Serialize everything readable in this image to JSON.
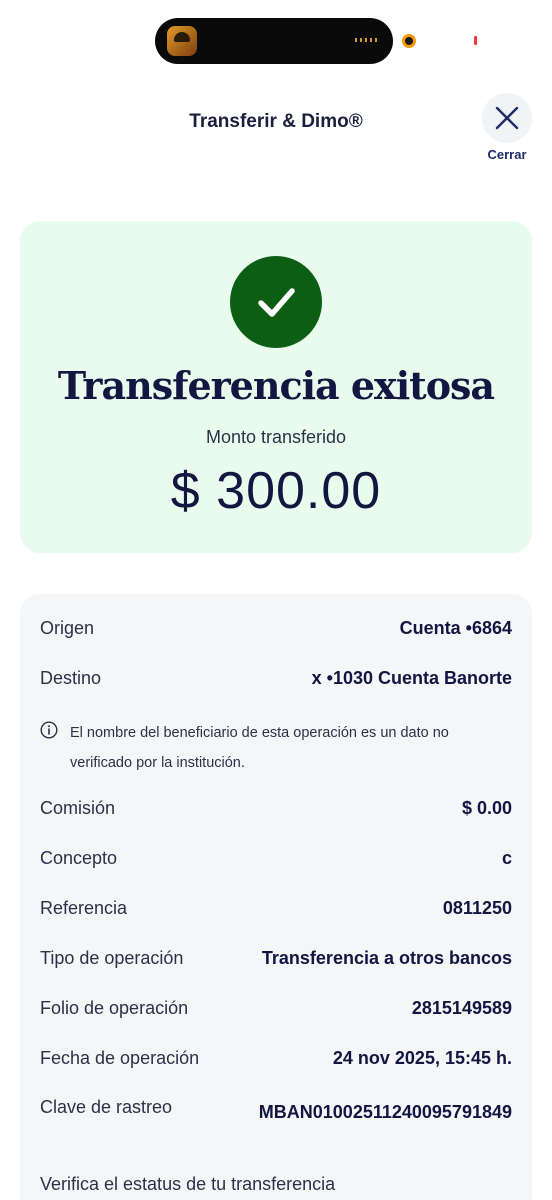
{
  "header": {
    "title": "Transferir & Dimo®",
    "close_label": "Cerrar"
  },
  "success": {
    "title": "Transferencia exitosa",
    "amount_label": "Monto transferido",
    "amount_value": "$ 300.00",
    "accent_color": "#0b5e14",
    "card_color": "#e9fbed"
  },
  "details": {
    "rows": [
      {
        "label": "Origen",
        "value": "Cuenta •6864"
      },
      {
        "label": "Destino",
        "value": "x •1030 Cuenta Banorte"
      },
      {
        "label": "Comisión",
        "value": "$ 0.00"
      },
      {
        "label": "Concepto",
        "value": "c"
      },
      {
        "label": "Referencia",
        "value": "0811250"
      },
      {
        "label": "Tipo de operación",
        "value": "Transferencia a otros bancos"
      },
      {
        "label": "Folio de operación",
        "value": "2815149589"
      },
      {
        "label": "Fecha de operación",
        "value": "24 nov 2025, 15:45 h."
      },
      {
        "label": "Clave de rastreo",
        "value": "MBAN01002511240095791849"
      }
    ],
    "notice": "El nombre del beneficiario de esta operación es un dato no verificado por la institución.",
    "verify_link": "Verifica el estatus de tu transferencia"
  },
  "icons": {
    "close": "close-icon",
    "check": "check-icon",
    "info": "info-icon"
  }
}
